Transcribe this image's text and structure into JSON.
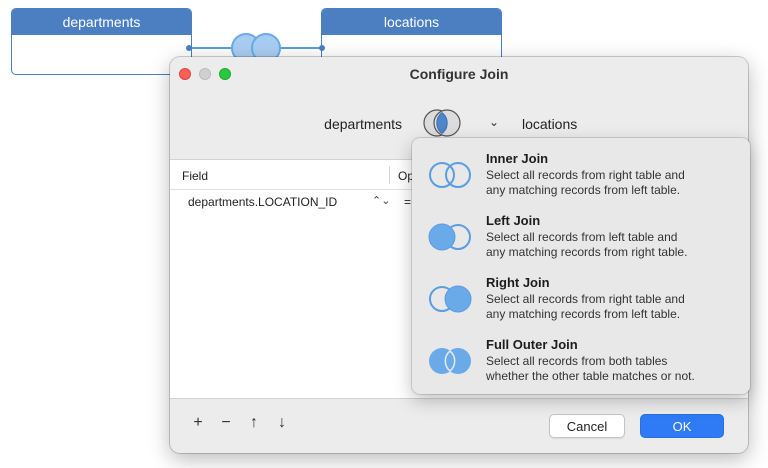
{
  "diagram": {
    "left_table": "departments",
    "right_table": "locations"
  },
  "dialog": {
    "title": "Configure Join",
    "left_table": "departments",
    "right_table": "locations",
    "columns": {
      "field": "Field",
      "operator": "Op"
    },
    "rows": [
      {
        "field": "departments.LOCATION_ID",
        "operator": "="
      }
    ],
    "footer": {
      "add": "+",
      "remove": "−",
      "up": "↑",
      "down": "↓",
      "cancel": "Cancel",
      "ok": "OK"
    }
  },
  "join_menu": {
    "options": [
      {
        "name": "Inner Join",
        "line1": "Select all records from right table and",
        "line2": "any matching records from left table."
      },
      {
        "name": "Left Join",
        "line1": "Select all records from left table and",
        "line2": "any matching records from right table."
      },
      {
        "name": "Right Join",
        "line1": "Select all records from right table and",
        "line2": "any matching records from left table."
      },
      {
        "name": "Full Outer Join",
        "line1": "Select all records from both tables",
        "line2": "whether the other table matches or not."
      }
    ]
  },
  "colors": {
    "table_header": "#4b7fc2",
    "join_fill": "#6aaae8",
    "join_stroke": "#5a9de0",
    "ok_button": "#2f7bf6"
  },
  "icons": {
    "selector": "venn-inner-icon",
    "chevron": "chevron-down-icon"
  }
}
